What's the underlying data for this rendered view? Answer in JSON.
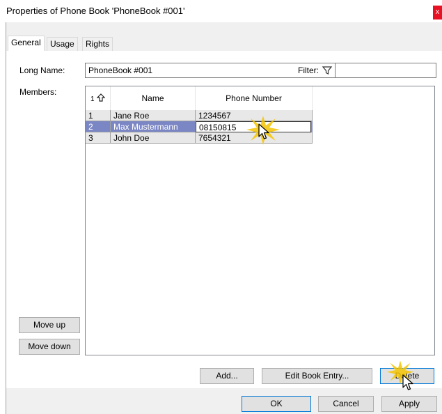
{
  "window": {
    "title": "Properties of Phone Book 'PhoneBook #001'",
    "close": "x"
  },
  "tabs": [
    {
      "label": "General",
      "active": true
    },
    {
      "label": "Usage",
      "active": false
    },
    {
      "label": "Rights",
      "active": false
    }
  ],
  "general": {
    "long_name_label": "Long Name:",
    "long_name_value": "PhoneBook #001",
    "filter_label": "Filter:",
    "filter_value": "",
    "members_label": "Members:",
    "move_up": "Move up",
    "move_down": "Move down"
  },
  "members_table": {
    "sort_indicator": "1",
    "columns": [
      "Name",
      "Phone Number"
    ],
    "rows": [
      {
        "index": "1",
        "name": "Jane Roe",
        "phone": "1234567",
        "selected": false
      },
      {
        "index": "2",
        "name": "Max Mustermann",
        "phone": "08150815",
        "selected": true
      },
      {
        "index": "3",
        "name": "John Doe",
        "phone": "7654321",
        "selected": false
      }
    ]
  },
  "actions": {
    "add": "Add...",
    "edit": "Edit Book Entry...",
    "delete": "Delete"
  },
  "dialog_buttons": {
    "ok": "OK",
    "cancel": "Cancel",
    "apply": "Apply"
  },
  "colors": {
    "selection": "#7b86c4",
    "close": "#e81123",
    "accent": "#0078d7",
    "highlight": "#f5c400"
  },
  "icons": {
    "filter": "funnel-icon",
    "sort": "sort-up-arrow-icon",
    "cursor": "mouse-pointer-icon",
    "click": "click-burst-icon"
  }
}
